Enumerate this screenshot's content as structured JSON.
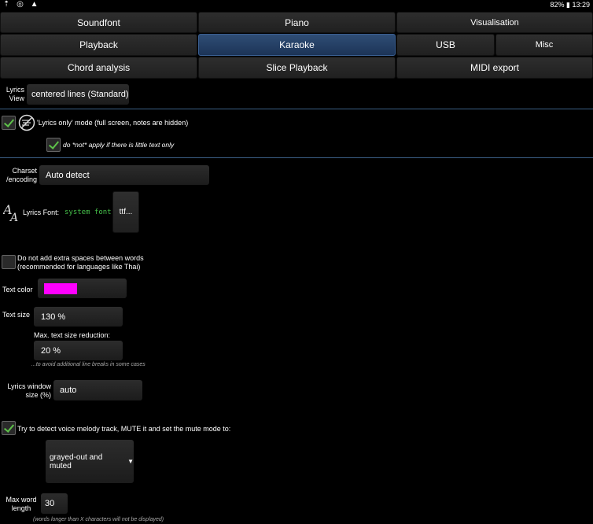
{
  "status": {
    "left": "⇡ ◎ ▲",
    "right": "82% ▮ 13:29"
  },
  "tabs": {
    "row1": [
      "Soundfont",
      "Piano",
      "Visualisation"
    ],
    "row2": [
      "Playback",
      "Karaoke",
      "USB",
      "Misc"
    ],
    "row3": [
      "Chord analysis",
      "Slice Playback",
      "MIDI export"
    ],
    "active": "Karaoke"
  },
  "lyrics_view": {
    "label": "Lyrics View",
    "value": "centered lines (Standard)"
  },
  "lyrics_only": {
    "label": "'Lyrics only' mode (full screen, notes are hidden)",
    "checked": true
  },
  "lyrics_only_sub": {
    "label": "do *not* apply if there is little text only",
    "checked": true
  },
  "charset": {
    "label": "Charset /encoding",
    "value": "Auto detect"
  },
  "font": {
    "label": "Lyrics Font:",
    "value": "system font",
    "button": "ttf..."
  },
  "no_spaces": {
    "label": "Do not add extra spaces between words (recommended for languages like Thai)",
    "checked": false
  },
  "text_color": {
    "label": "Text color",
    "color": "#ff00ff"
  },
  "text_size": {
    "label": "Text size",
    "value": "130 %"
  },
  "max_reduction": {
    "label": "Max. text size reduction:",
    "value": "20 %",
    "note": "...to avoid additional line breaks in some cases"
  },
  "window_size": {
    "label": "Lyrics window size (%)",
    "value": "auto"
  },
  "voice_detect": {
    "label": "Try to detect voice melody track, MUTE it and set the mute mode to:",
    "checked": true
  },
  "mute_mode": {
    "value": "grayed-out and muted"
  },
  "max_word": {
    "label": "Max word length",
    "value": "30",
    "note": "(words longer than X characters will not be displayed)"
  }
}
